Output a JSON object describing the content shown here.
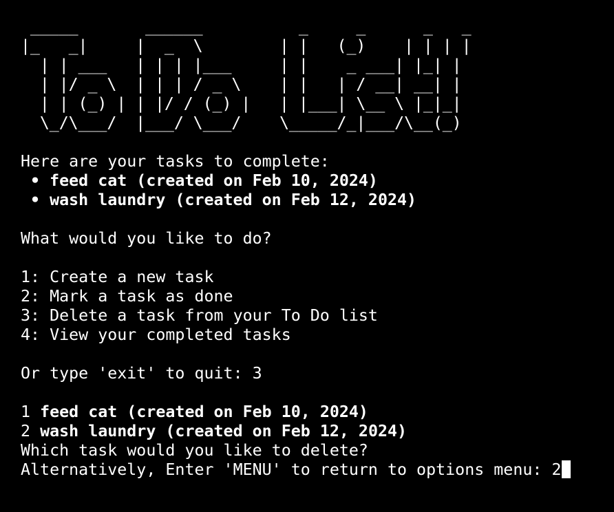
{
  "theme": {
    "background": "#000000",
    "foreground": "#ffffff"
  },
  "banner": [
    " _____       ______          _     _      _   _ ",
    "|_   _|     |  _  \\        | |   (_)    | | | |",
    "  | | ___   | | | |___     | |    _ ___| |_| |",
    "  | |/ _ \\  | | | / _ \\    | |   | / __| __| |",
    "  | | (_) | | |/ / (_) |   | |___| \\__ \\ |_|_|",
    "  \\_/\\___/  |___/ \\___/    \\_____/_|___/\\__(_)"
  ],
  "tasks": {
    "heading": "Here are your tasks to complete:",
    "bullet": "•",
    "items": [
      "feed cat (created on Feb 10, 2024)",
      "wash laundry (created on Feb 12, 2024)"
    ]
  },
  "menu": {
    "question": "What would you like to do?",
    "options": [
      "1: Create a new task",
      "2: Mark a task as done",
      "3: Delete a task from your To Do list",
      "4: View your completed tasks"
    ],
    "exit_prompt": "Or type 'exit' to quit: ",
    "exit_answer": "3"
  },
  "delete": {
    "items": [
      {
        "num": "1 ",
        "text": "feed cat (created on Feb 10, 2024)"
      },
      {
        "num": "2 ",
        "text": "wash laundry (created on Feb 12, 2024)"
      }
    ],
    "question": "Which task would you like to delete?",
    "menu_prompt": "Alternatively, Enter 'MENU' to return to options menu: ",
    "menu_answer": "2"
  }
}
